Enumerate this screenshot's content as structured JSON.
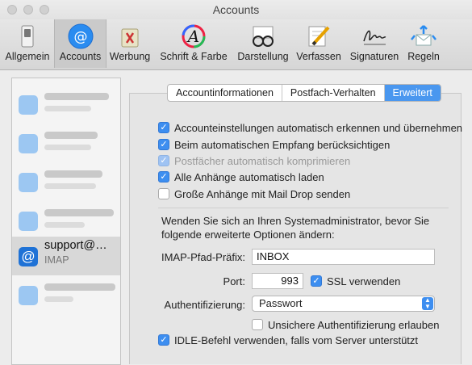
{
  "window": {
    "title": "Accounts"
  },
  "toolbar": {
    "items": [
      {
        "label": "Allgemein",
        "icon": "switch-icon"
      },
      {
        "label": "Accounts",
        "icon": "at-icon"
      },
      {
        "label": "Werbung",
        "icon": "trash-icon"
      },
      {
        "label": "Schrift & Farbe",
        "icon": "font-icon"
      },
      {
        "label": "Darstellung",
        "icon": "glasses-icon"
      },
      {
        "label": "Verfassen",
        "icon": "pencil-icon"
      },
      {
        "label": "Signaturen",
        "icon": "signature-icon"
      },
      {
        "label": "Regeln",
        "icon": "rules-icon"
      }
    ]
  },
  "sidebar": {
    "selected": {
      "name": "support@…",
      "type": "IMAP"
    }
  },
  "tabs": {
    "items": [
      "Accountinformationen",
      "Postfach-Verhalten",
      "Erweitert"
    ],
    "active": "Erweitert"
  },
  "options": {
    "auto_detect": {
      "label": "Accounteinstellungen automatisch erkennen und übernehmen",
      "checked": true
    },
    "include_auto_fetch": {
      "label": "Beim automatischen Empfang berücksichtigen",
      "checked": true
    },
    "compress_mailboxes": {
      "label": "Postfächer automatisch komprimieren",
      "checked": true,
      "enabled": false
    },
    "download_attachments": {
      "label": "Alle Anhänge automatisch laden",
      "checked": true
    },
    "mail_drop": {
      "label": "Große Anhänge mit Mail Drop senden",
      "checked": false
    }
  },
  "advanced": {
    "note": "Wenden Sie sich an Ihren Systemadministrator, bevor Sie folgende erweiterte Optionen ändern:",
    "imap_prefix_label": "IMAP-Pfad-Präfix:",
    "imap_prefix_value": "INBOX",
    "port_label": "Port:",
    "port_value": "993",
    "ssl_label": "SSL verwenden",
    "ssl_checked": true,
    "auth_label": "Authentifizierung:",
    "auth_value": "Passwort",
    "insecure_auth_label": "Unsichere Authentifizierung erlauben",
    "insecure_auth_checked": false,
    "idle_label": "IDLE-Befehl verwenden, falls vom Server unterstützt",
    "idle_checked": true
  },
  "colors": {
    "accent": "#3d8ef0",
    "tab_active": "#4a97ef"
  }
}
